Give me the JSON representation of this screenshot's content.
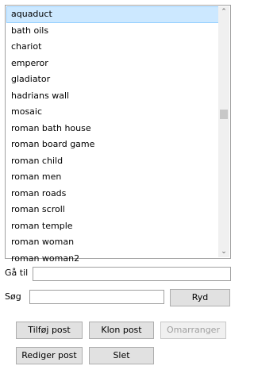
{
  "list": {
    "items": [
      "aquaduct",
      "bath oils",
      "chariot",
      "emperor",
      "gladiator",
      "hadrians wall",
      "mosaic",
      "roman bath house",
      "roman board game",
      "roman child",
      "roman men",
      "roman roads",
      "roman scroll",
      "roman temple",
      "roman woman",
      "roman woman2"
    ],
    "selected_index": 0
  },
  "scrollbar": {
    "up_glyph": "⌃",
    "down_glyph": "⌄"
  },
  "goto": {
    "label": "Gå til",
    "value": ""
  },
  "search": {
    "label": "Søg",
    "value": "",
    "clear_label": "Ryd"
  },
  "buttons": {
    "add": "Tilføj post",
    "clone": "Klon post",
    "reorder": "Omarranger",
    "edit": "Rediger post",
    "delete": "Slet"
  }
}
